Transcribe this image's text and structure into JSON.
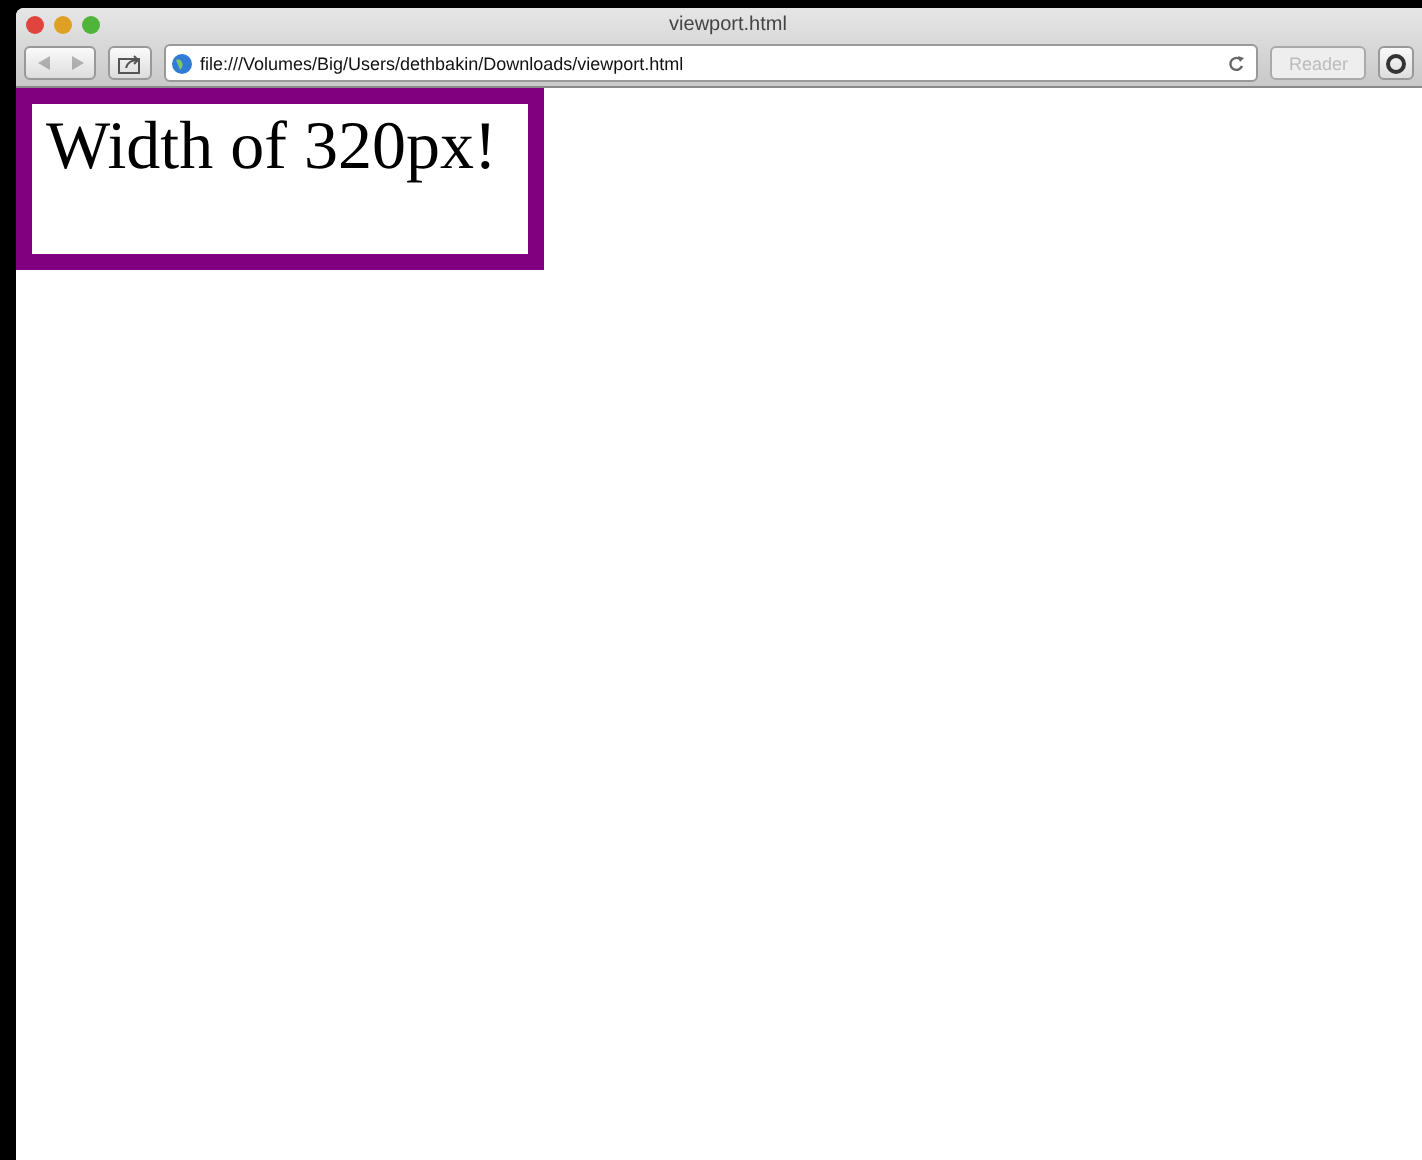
{
  "window": {
    "title": "viewport.html"
  },
  "toolbar": {
    "back_disabled": true,
    "forward_disabled": true,
    "address": "file:///Volumes/Big/Users/dethbakin/Downloads/viewport.html",
    "reader": {
      "label": "Reader",
      "disabled": true
    }
  },
  "page": {
    "heading": "Width of 320px!"
  }
}
